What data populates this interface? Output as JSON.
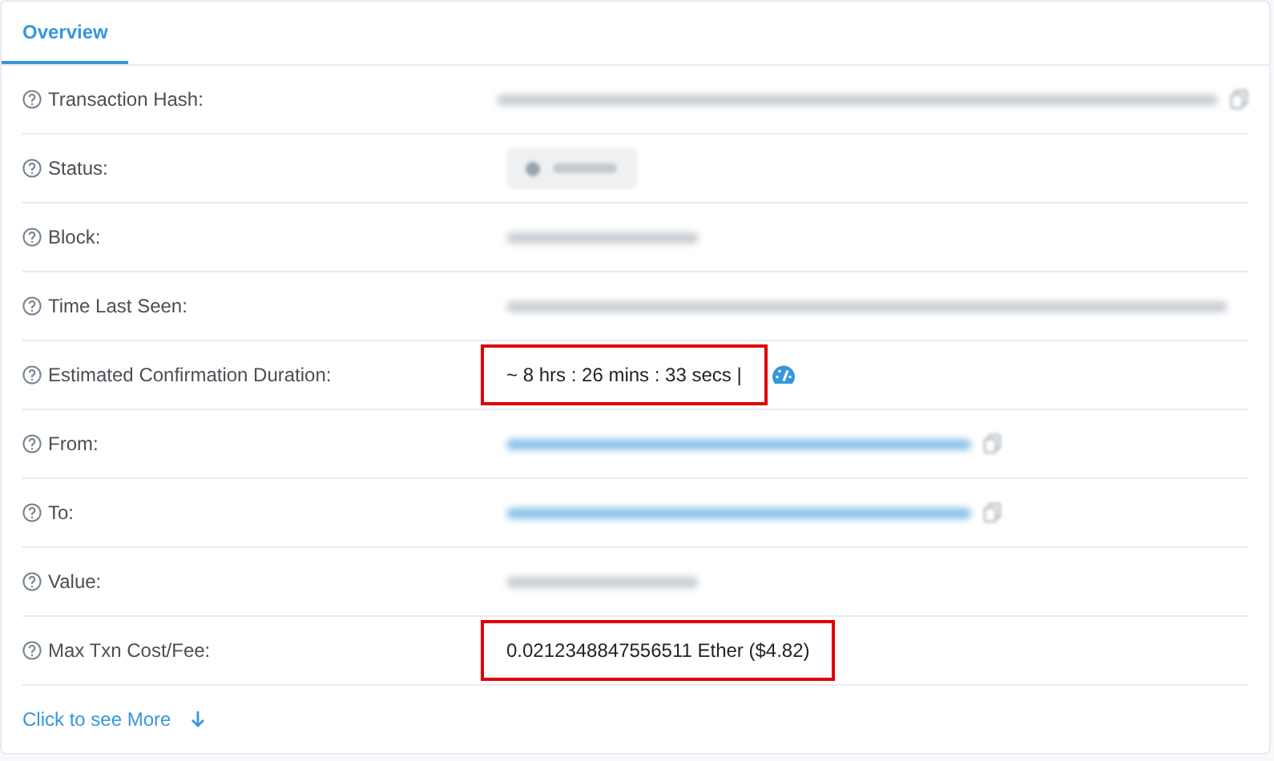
{
  "tabs": [
    {
      "label": "Overview",
      "selected": true
    }
  ],
  "rows": [
    {
      "label": "Transaction Hash:",
      "kind": "blurred_long",
      "copy": true
    },
    {
      "label": "Status:",
      "kind": "blurred_badge"
    },
    {
      "label": "Block:",
      "kind": "blurred_short"
    },
    {
      "label": "Time Last Seen:",
      "kind": "blurred_long"
    },
    {
      "label": "Estimated Confirmation Duration:",
      "kind": "timer",
      "value": "~ 8 hrs : 26 mins : 33 secs |",
      "highlighted": true
    },
    {
      "label": "From:",
      "kind": "blurred_link",
      "copy": true
    },
    {
      "label": "To:",
      "kind": "blurred_link",
      "copy": true
    },
    {
      "label": "Value:",
      "kind": "blurred_short"
    },
    {
      "label": "Max Txn Cost/Fee:",
      "kind": "text",
      "value": "0.0212348847556511 Ether ($4.82)",
      "highlighted": true
    }
  ],
  "more_link": "Click to see More"
}
